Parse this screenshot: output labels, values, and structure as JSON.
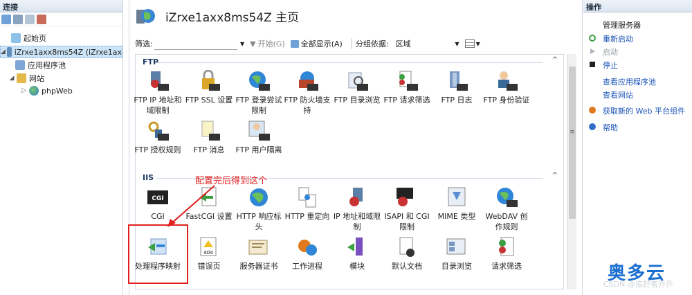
{
  "left_pane": {
    "header": "连接",
    "tree": [
      {
        "label": "起始页",
        "icon": "start-page-icon",
        "depth": 1
      },
      {
        "label": "iZrxe1axx8ms54Z (iZrxe1ax",
        "icon": "server-icon",
        "depth": 0,
        "selected": true
      },
      {
        "label": "应用程序池",
        "icon": "app-pool-icon",
        "depth": 1
      },
      {
        "label": "网站",
        "icon": "sites-folder-icon",
        "depth": 1
      },
      {
        "label": "phpWeb",
        "icon": "globe-icon",
        "depth": 2
      }
    ]
  },
  "center": {
    "title": "iZrxe1axx8ms54Z 主页",
    "filter": {
      "label": "筛选:",
      "start": "开始(G)",
      "show_all": "全部显示(A)",
      "group_by_label": "分组依据:",
      "group_by_value": "区域"
    },
    "groups": [
      {
        "name": "FTP",
        "features": [
          "FTP IP 地址和域限制",
          "FTP SSL 设置",
          "FTP 登录尝试限制",
          "FTP 防火墙支持",
          "FTP 目录浏览",
          "FTP 请求筛选",
          "FTP 日志",
          "FTP 身份验证",
          "FTP 授权规则",
          "FTP 消息",
          "FTP 用户隔离"
        ]
      },
      {
        "name": "IIS",
        "features": [
          "CGI",
          "FastCGI 设置",
          "HTTP 响应标头",
          "HTTP 重定向",
          "IP 地址和域限制",
          "ISAPI 和 CGI 限制",
          "MIME 类型",
          "WebDAV 创作规则",
          "处理程序映射",
          "错误页",
          "服务器证书",
          "工作进程",
          "模块",
          "默认文档",
          "目录浏览",
          "请求筛选"
        ]
      }
    ],
    "annotation": "配置完后得到这个"
  },
  "right_pane": {
    "header": "操作",
    "section": "管理服务器",
    "actions": [
      {
        "label": "重新启动",
        "enabled": true
      },
      {
        "label": "启动",
        "enabled": false
      },
      {
        "label": "停止",
        "enabled": true
      },
      {
        "label": "查看应用程序池",
        "enabled": true
      },
      {
        "label": "查看网站",
        "enabled": true
      },
      {
        "label": "获取新的 Web 平台组件",
        "enabled": true
      },
      {
        "label": "帮助",
        "enabled": true
      }
    ]
  },
  "brand": "奥多云",
  "watermark": "CSDN @追赶者乔乔",
  "colors": {
    "link": "#1a55b8",
    "annotation": "#e02020",
    "brand": "#1a6fd0"
  }
}
